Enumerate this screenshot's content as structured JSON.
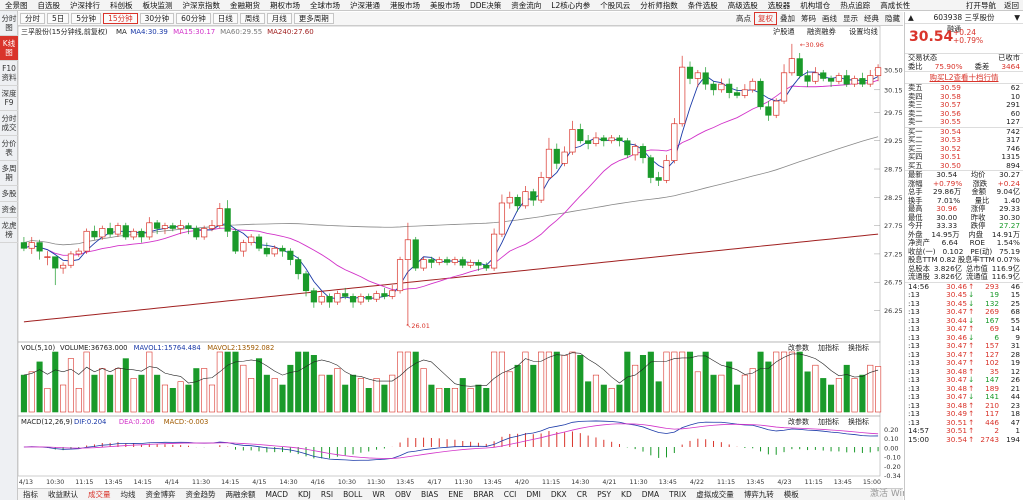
{
  "topmenu": [
    "全景图",
    "自选股",
    "沪深排行",
    "科创板",
    "板块监测",
    "沪深京指数",
    "金融期货",
    "期权市场",
    "全球市场",
    "沪深港通",
    "港股市场",
    "美股市场",
    "DDE决策",
    "资金流向",
    "L2核心内参",
    "个股风云",
    "分析师指数",
    "条件选股",
    "高级选股",
    "选股器",
    "机构增仓",
    "热点追踪",
    "高成长性"
  ],
  "topmenu_right": [
    "打开导航",
    "返回"
  ],
  "leftbar": [
    "分时图",
    "K线图",
    "F10资料",
    "深度F9",
    "分时成交",
    "分价表",
    "多周期",
    "多股",
    "资金",
    "龙虎榜"
  ],
  "timeframes": [
    "分时",
    "5日",
    "5分钟",
    "15分钟",
    "30分钟",
    "60分钟",
    "日线",
    "周线",
    "月线",
    "更多周期"
  ],
  "tf_right": [
    "高点",
    "复权",
    "叠加",
    "筹码",
    "画线",
    "显示",
    "经典",
    "隐藏"
  ],
  "stock": {
    "code": "603938",
    "name": "三孚股份",
    "sector": "融通",
    "price": "30.54",
    "chg": "+0.24",
    "pct": "+0.79%",
    "state_label": "交易状态",
    "state": "已收市",
    "wb_label": "委比",
    "wb": "75.90%",
    "wc_label": "委差",
    "wc": "3464"
  },
  "banner": "购买L2查看十档行情",
  "sells": [
    [
      "卖五",
      "30.59",
      "62"
    ],
    [
      "卖四",
      "30.58",
      "10"
    ],
    [
      "卖三",
      "30.57",
      "291"
    ],
    [
      "卖二",
      "30.56",
      "60"
    ],
    [
      "卖一",
      "30.55",
      "127"
    ]
  ],
  "buys": [
    [
      "买一",
      "30.54",
      "742"
    ],
    [
      "买二",
      "30.53",
      "317"
    ],
    [
      "买三",
      "30.52",
      "746"
    ],
    [
      "买四",
      "30.51",
      "1315"
    ],
    [
      "买五",
      "30.50",
      "894"
    ]
  ],
  "stats": [
    [
      "最新",
      "30.54",
      "均价",
      "30.27"
    ],
    [
      "涨幅",
      "+0.79%",
      "涨跌",
      "+0.24"
    ],
    [
      "总手",
      "29.86万",
      "金额",
      "9.04亿"
    ],
    [
      "换手",
      "7.01%",
      "量比",
      "1.40"
    ],
    [
      "最高",
      "30.96",
      "涨停",
      "29.33"
    ],
    [
      "最低",
      "30.00",
      "昨收",
      "30.30"
    ],
    [
      "今开",
      "33.33",
      "跌停",
      "27.27"
    ],
    [
      "外盘",
      "14.95万",
      "内盘",
      "14.91万"
    ],
    [
      "净资产",
      "6.64",
      "ROE",
      "1.54%"
    ],
    [
      "收益(一)",
      "0.102",
      "PE(动)",
      "75.19"
    ],
    [
      "股息TTM",
      "0.82",
      "股息率TTM",
      "0.07%"
    ],
    [
      "总股本",
      "3.826亿",
      "总市值",
      "116.9亿"
    ],
    [
      "流通股",
      "3.826亿",
      "流通值",
      "116.9亿"
    ]
  ],
  "trades": [
    [
      "14:56",
      "30.46",
      "↑",
      "293",
      "46"
    ],
    [
      ":13",
      "30.45",
      "↓",
      "19",
      "15"
    ],
    [
      ":13",
      "30.45",
      "↓",
      "132",
      "25"
    ],
    [
      ":13",
      "30.47",
      "↑",
      "269",
      "68"
    ],
    [
      ":13",
      "30.44",
      "↓",
      "167",
      "55"
    ],
    [
      ":13",
      "30.47",
      "↑",
      "69",
      "14"
    ],
    [
      ":13",
      "30.46",
      "↓",
      "6",
      "9"
    ],
    [
      ":13",
      "30.47",
      "↑",
      "157",
      "31"
    ],
    [
      ":13",
      "30.47",
      "↑",
      "127",
      "28"
    ],
    [
      ":13",
      "30.47",
      "↑",
      "102",
      "19"
    ],
    [
      ":13",
      "30.48",
      "↑",
      "35",
      "12"
    ],
    [
      ":13",
      "30.47",
      "↓",
      "147",
      "26"
    ],
    [
      ":13",
      "30.48",
      "↑",
      "189",
      "21"
    ],
    [
      ":13",
      "30.47",
      "↓",
      "141",
      "44"
    ],
    [
      ":13",
      "30.48",
      "↑",
      "210",
      "23"
    ],
    [
      ":13",
      "30.49",
      "↑",
      "117",
      "18"
    ],
    [
      ":13",
      "30.51",
      "↑",
      "446",
      "47"
    ],
    [
      "14:57",
      "30.51",
      "↑",
      "2",
      "1"
    ],
    [
      "15:00",
      "30.54",
      "↑",
      "2743",
      "194"
    ]
  ],
  "bottomtabs": [
    "指标",
    "收益默认",
    "成交量",
    "均线",
    "资金博弈",
    "资金趋势",
    "两融余额",
    "MACD",
    "KDJ",
    "RSI",
    "BOLL",
    "WR",
    "OBV",
    "BIAS",
    "ENE",
    "BRAR",
    "CCI",
    "DMI",
    "DKX",
    "CR",
    "PSY",
    "KD",
    "DMA",
    "TRIX",
    "虚拟成交量",
    "博弈九转",
    "模板"
  ],
  "watermark": "激活 Windows",
  "chart_data": {
    "type": "candlestick",
    "title": "三孚股份(15分钟线,前复权)",
    "ma_labels": [
      "MA",
      "MA4:30.39",
      "MA15:30.17",
      "MA60:29.55",
      "MA240:27.60"
    ],
    "chart_tools": [
      "沪股通",
      "融资融券",
      "设置均线"
    ],
    "high_label": "30.96",
    "low_label": "26.01",
    "ylim": [
      25.8,
      31.1
    ],
    "y_ticks": [
      30.5,
      30.15,
      29.75,
      29.25,
      28.75,
      28.25,
      27.75,
      27.25,
      26.75,
      26.25
    ],
    "x_labels": [
      "4/13",
      "10:30",
      "11:15",
      "13:45",
      "14:15",
      "4/14",
      "11:30",
      "14:15",
      "4/15",
      "14:30",
      "4/16",
      "10:30",
      "11:30",
      "13:45",
      "4/17",
      "11:30",
      "13:45",
      "4/20",
      "11:15",
      "14:30",
      "4/21",
      "11:30",
      "13:45",
      "4/22",
      "11:15",
      "13:45",
      "4/23",
      "11:15",
      "13:45",
      "15:00"
    ],
    "candles": [
      [
        27.45,
        27.35,
        27.55,
        27.3
      ],
      [
        27.35,
        27.45,
        27.55,
        27.25
      ],
      [
        27.45,
        27.3,
        27.5,
        27.15
      ],
      [
        27.2,
        27.2,
        27.3,
        27.05
      ],
      [
        27.2,
        27.0,
        27.2,
        26.7
      ],
      [
        27.0,
        27.05,
        27.1,
        26.9
      ],
      [
        27.05,
        27.25,
        27.3,
        27.0
      ],
      [
        27.25,
        27.3,
        27.35,
        27.2
      ],
      [
        27.3,
        27.65,
        27.7,
        27.25
      ],
      [
        27.65,
        27.55,
        27.75,
        27.5
      ],
      [
        27.55,
        27.7,
        27.75,
        27.5
      ],
      [
        27.7,
        27.6,
        27.8,
        27.55
      ],
      [
        27.6,
        27.75,
        27.8,
        27.55
      ],
      [
        27.75,
        27.55,
        27.8,
        27.5
      ],
      [
        27.55,
        27.65,
        27.7,
        27.5
      ],
      [
        27.65,
        27.55,
        27.7,
        27.45
      ],
      [
        27.55,
        27.8,
        27.9,
        27.5
      ],
      [
        27.8,
        27.7,
        27.85,
        27.6
      ],
      [
        27.7,
        27.75,
        27.8,
        27.6
      ],
      [
        27.75,
        27.7,
        27.8,
        27.65
      ],
      [
        27.7,
        27.75,
        27.85,
        27.6
      ],
      [
        27.75,
        27.7,
        27.8,
        27.6
      ],
      [
        27.7,
        27.55,
        27.75,
        27.5
      ],
      [
        27.55,
        27.7,
        27.75,
        27.5
      ],
      [
        27.7,
        27.75,
        27.85,
        27.65
      ],
      [
        27.75,
        28.05,
        28.15,
        27.7
      ],
      [
        28.05,
        27.65,
        28.2,
        27.55
      ],
      [
        27.65,
        27.3,
        27.7,
        27.25
      ],
      [
        27.3,
        27.45,
        27.5,
        27.2
      ],
      [
        27.45,
        27.55,
        27.6,
        27.4
      ],
      [
        27.55,
        27.35,
        27.6,
        27.3
      ],
      [
        27.35,
        27.25,
        27.45,
        27.2
      ],
      [
        27.25,
        27.35,
        27.4,
        27.2
      ],
      [
        27.35,
        27.3,
        27.4,
        27.2
      ],
      [
        27.3,
        27.15,
        27.35,
        27.05
      ],
      [
        27.15,
        26.9,
        27.2,
        26.8
      ],
      [
        26.9,
        26.6,
        26.95,
        26.5
      ],
      [
        26.6,
        26.4,
        26.65,
        26.3
      ],
      [
        26.4,
        26.5,
        26.6,
        26.35
      ],
      [
        26.5,
        26.4,
        26.55,
        26.3
      ],
      [
        26.4,
        26.55,
        26.6,
        26.35
      ],
      [
        26.55,
        26.5,
        26.65,
        26.45
      ],
      [
        26.5,
        26.4,
        26.55,
        26.3
      ],
      [
        26.4,
        26.5,
        26.55,
        26.35
      ],
      [
        26.5,
        26.45,
        26.55,
        26.4
      ],
      [
        26.45,
        26.55,
        26.6,
        26.4
      ],
      [
        26.55,
        26.5,
        26.65,
        26.45
      ],
      [
        26.5,
        26.6,
        26.7,
        26.45
      ],
      [
        26.6,
        27.15,
        27.2,
        26.55
      ],
      [
        27.15,
        27.5,
        27.8,
        26.01
      ],
      [
        27.5,
        27.0,
        27.55,
        26.95
      ],
      [
        27.0,
        27.15,
        27.2,
        26.95
      ],
      [
        27.15,
        27.1,
        27.2,
        27.0
      ],
      [
        27.1,
        27.15,
        27.2,
        27.05
      ],
      [
        27.15,
        27.1,
        27.2,
        27.05
      ],
      [
        27.1,
        27.15,
        27.2,
        27.05
      ],
      [
        27.15,
        27.05,
        27.2,
        27.0
      ],
      [
        27.05,
        27.1,
        27.15,
        27.0
      ],
      [
        27.1,
        27.05,
        27.15,
        26.95
      ],
      [
        27.05,
        27.0,
        27.1,
        26.95
      ],
      [
        27.0,
        27.6,
        27.7,
        26.95
      ],
      [
        27.6,
        28.15,
        28.3,
        27.55
      ],
      [
        28.15,
        28.25,
        28.35,
        28.05
      ],
      [
        28.25,
        28.1,
        28.3,
        28.0
      ],
      [
        28.1,
        28.35,
        28.45,
        28.05
      ],
      [
        28.35,
        28.2,
        28.4,
        28.1
      ],
      [
        28.2,
        28.6,
        28.7,
        28.15
      ],
      [
        28.6,
        29.1,
        29.3,
        28.55
      ],
      [
        29.1,
        28.85,
        29.2,
        28.75
      ],
      [
        28.85,
        29.05,
        29.15,
        28.8
      ],
      [
        29.05,
        29.45,
        29.6,
        29.0
      ],
      [
        29.45,
        29.25,
        29.55,
        29.2
      ],
      [
        29.25,
        29.2,
        29.35,
        29.1
      ],
      [
        29.2,
        29.3,
        29.4,
        29.15
      ],
      [
        29.3,
        29.25,
        29.35,
        29.15
      ],
      [
        29.25,
        29.3,
        29.35,
        29.2
      ],
      [
        29.3,
        29.25,
        29.35,
        29.15
      ],
      [
        29.25,
        29.0,
        29.3,
        28.95
      ],
      [
        29.0,
        29.15,
        29.2,
        28.9
      ],
      [
        29.15,
        28.95,
        29.2,
        28.85
      ],
      [
        28.95,
        28.6,
        29.0,
        28.5
      ],
      [
        28.6,
        28.55,
        28.7,
        28.45
      ],
      [
        28.55,
        28.9,
        29.0,
        28.5
      ],
      [
        28.9,
        29.55,
        29.65,
        28.85
      ],
      [
        29.55,
        30.55,
        30.75,
        29.5
      ],
      [
        30.55,
        30.35,
        30.65,
        30.25
      ],
      [
        30.35,
        30.45,
        30.5,
        30.2
      ],
      [
        30.45,
        30.25,
        30.55,
        30.15
      ],
      [
        30.25,
        30.15,
        30.3,
        30.05
      ],
      [
        30.15,
        30.25,
        30.35,
        30.1
      ],
      [
        30.25,
        30.1,
        30.35,
        30.0
      ],
      [
        30.1,
        30.05,
        30.2,
        30.0
      ],
      [
        30.05,
        30.15,
        30.25,
        30.0
      ],
      [
        30.15,
        30.3,
        30.35,
        30.1
      ],
      [
        30.3,
        29.85,
        30.35,
        29.8
      ],
      [
        29.85,
        29.7,
        29.95,
        29.6
      ],
      [
        29.7,
        29.95,
        30.0,
        29.65
      ],
      [
        29.95,
        30.45,
        30.6,
        29.9
      ],
      [
        30.45,
        30.7,
        30.96,
        30.4
      ],
      [
        30.7,
        30.4,
        30.8,
        30.35
      ],
      [
        30.4,
        30.3,
        30.5,
        30.2
      ],
      [
        30.3,
        30.45,
        30.55,
        30.25
      ],
      [
        30.45,
        30.35,
        30.5,
        30.3
      ],
      [
        30.35,
        30.3,
        30.4,
        30.2
      ],
      [
        30.3,
        30.4,
        30.45,
        30.25
      ],
      [
        30.4,
        30.25,
        30.5,
        30.2
      ],
      [
        30.25,
        30.35,
        30.4,
        30.2
      ],
      [
        30.35,
        30.25,
        30.45,
        30.2
      ],
      [
        30.25,
        30.4,
        30.5,
        30.2
      ],
      [
        30.4,
        30.54,
        30.6,
        30.3
      ]
    ],
    "volume": {
      "title": "VOL(5,10)",
      "labels": [
        "VOLUME:36763.000",
        "MAVOL1:15764.484",
        "MAVOL2:13592.082"
      ],
      "tools": [
        "改参数",
        "加指标",
        "换指标"
      ]
    },
    "macd": {
      "title": "MACD(12,26,9)",
      "labels": [
        "DIF:0.204",
        "DEA:0.206",
        "MACD:-0.003"
      ],
      "tools": [
        "改参数",
        "加指标",
        "换指标"
      ],
      "y_ticks": [
        "0.20",
        "0.10",
        "0.00",
        "-0.10",
        "-0.20",
        "-0.34"
      ]
    }
  }
}
